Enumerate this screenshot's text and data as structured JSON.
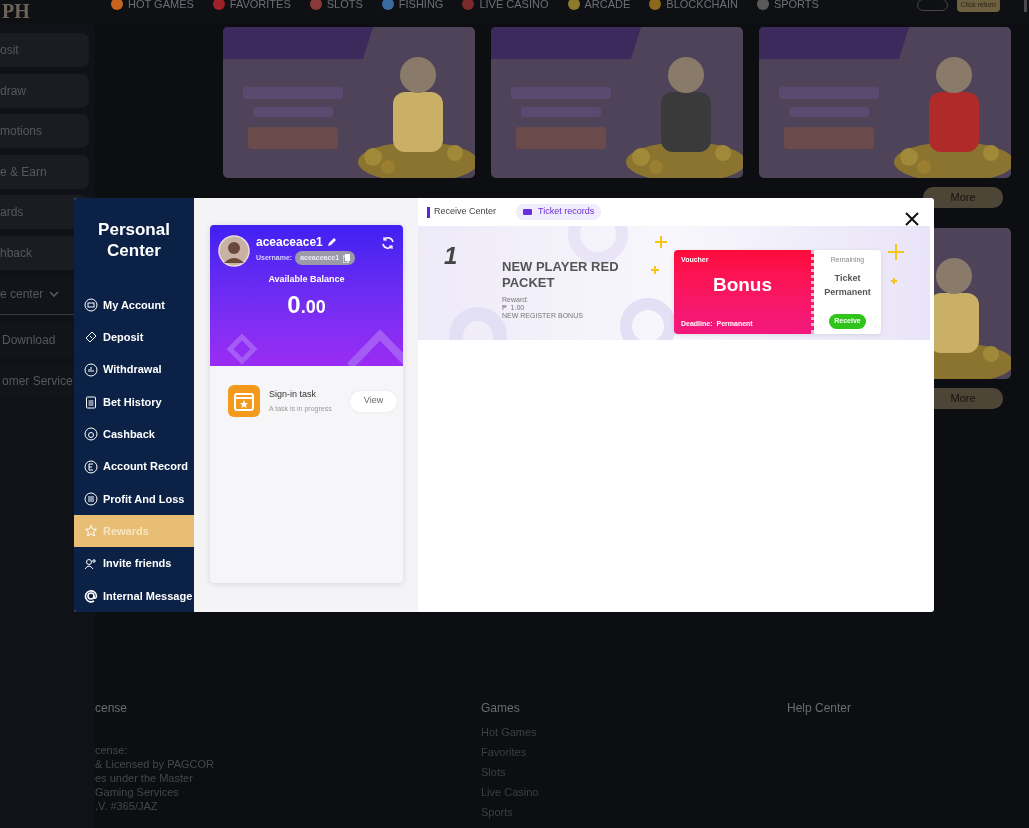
{
  "header": {
    "logo": "PH",
    "nav": [
      "HOT GAMES",
      "FAVORITES",
      "SLOTS",
      "FISHING",
      "LIVE CASINO",
      "ARCADE",
      "BLOCKCHAIN",
      "SPORTS"
    ],
    "return_button": "Click return"
  },
  "sidebar": {
    "items": [
      "osit",
      "draw",
      "motions",
      "e & Earn",
      "ards",
      "hback"
    ],
    "service": {
      "label": "e center",
      "expanded": false
    },
    "links": [
      "Download",
      "omer Service"
    ]
  },
  "promotions": [
    {
      "kind": "picture"
    },
    {
      "kind": "picture"
    },
    {
      "kind": "picture",
      "button": "More"
    },
    {
      "kind": "picture",
      "button": "More"
    }
  ],
  "footer": {
    "license": {
      "title": "cense",
      "lines": [
        "cense:",
        "& Licensed by PAGCOR",
        "es under the Master",
        "Gaming Services",
        ".V. #365/JAZ"
      ]
    },
    "games": {
      "title": "Games",
      "links": [
        "Hot Games",
        "Favorites",
        "Slots",
        "Live Casino",
        "Sports"
      ]
    },
    "help": {
      "title": "Help Center"
    }
  },
  "modal": {
    "title": "Personal Center",
    "nav": [
      {
        "label": "My Account",
        "selected": false
      },
      {
        "label": "Deposit",
        "selected": false
      },
      {
        "label": "Withdrawal",
        "selected": false
      },
      {
        "label": "Bet History",
        "selected": false
      },
      {
        "label": "Cashback",
        "selected": false
      },
      {
        "label": "Account Record",
        "selected": false
      },
      {
        "label": "Profit And Loss",
        "selected": false
      },
      {
        "label": "Rewards",
        "selected": true
      },
      {
        "label": "Invite friends",
        "selected": false
      },
      {
        "label": "Internal Message",
        "selected": false
      }
    ],
    "profile": {
      "name": "aceaceace1",
      "username_label": "Username:",
      "username": "aceaceace1",
      "balance_label": "Available Balance",
      "balance_whole": "0",
      "balance_fraction": ".00"
    },
    "task": {
      "title": "Sign-in task",
      "status": "A task is in progress",
      "button": "View"
    },
    "tab": "Receive Center",
    "records_button": "Ticket records",
    "packets": [
      {
        "number": "1",
        "title": "NEW PLAYER RED PACKET",
        "reward_label": "Reward:",
        "amount": "₱  1.00",
        "note": "NEW REGISTER BONUS",
        "voucher": {
          "label": "Voucher",
          "name": "Bonus",
          "deadline_label": "Deadline:",
          "deadline": "Permanent",
          "remaining_label": "Remaining",
          "remaining": "Ticket Permanent",
          "button": "Receive"
        }
      }
    ]
  }
}
